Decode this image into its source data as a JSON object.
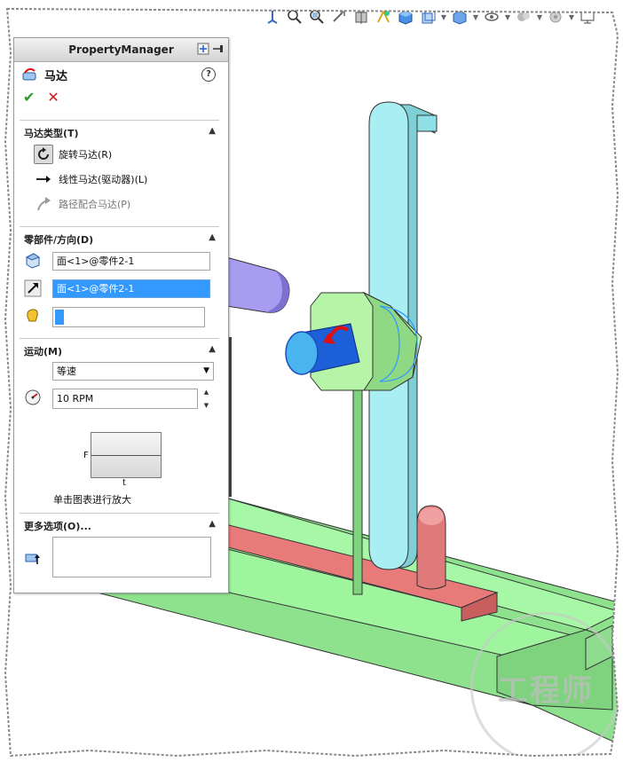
{
  "toolbar": {
    "icons": [
      "view-orientation-icon",
      "zoom-to-fit-icon",
      "zoom-area-icon",
      "previous-view-icon",
      "section-view-icon",
      "dynamic-annotation-icon",
      "view-orientation-cube-icon",
      "display-style-icon",
      "hide-show-icon",
      "edit-appearance-icon",
      "apply-scene-icon",
      "view-settings-icon",
      "monitor-icon"
    ]
  },
  "panel": {
    "title": "PropertyManager",
    "feature_name": "马达",
    "help_label": "?",
    "ok_symbol": "✔",
    "cancel_symbol": "✕"
  },
  "motor_type": {
    "title": "马达类型(T)",
    "options": [
      {
        "label": "旋转马达(R)",
        "selected": true,
        "enabled": true
      },
      {
        "label": "线性马达(驱动器)(L)",
        "selected": false,
        "enabled": true
      },
      {
        "label": "路径配合马达(P)",
        "selected": false,
        "enabled": false
      }
    ]
  },
  "component_direction": {
    "title": "零部件/方向(D)",
    "location_value": "面<1>@零件2-1",
    "direction_value": "面<1>@零件2-1",
    "relative_component_value": ""
  },
  "motion": {
    "title": "运动(M)",
    "function_value": "等速",
    "speed_value": "10 RPM",
    "graph_y_label": "F",
    "graph_x_label": "t",
    "graph_caption": "单击图表进行放大"
  },
  "more_options": {
    "title": "更多选项(O)..."
  },
  "colors": {
    "link_cyan": "#a8eef2",
    "base_green": "#9ef59e",
    "rail_red": "#e87a7a",
    "hex_block_green": "#b6f5a8",
    "shaft_blue": "#1d5fd6",
    "arm_purple": "#a89cf0",
    "accent_blue": "#3399ff"
  },
  "watermark": "工程师"
}
